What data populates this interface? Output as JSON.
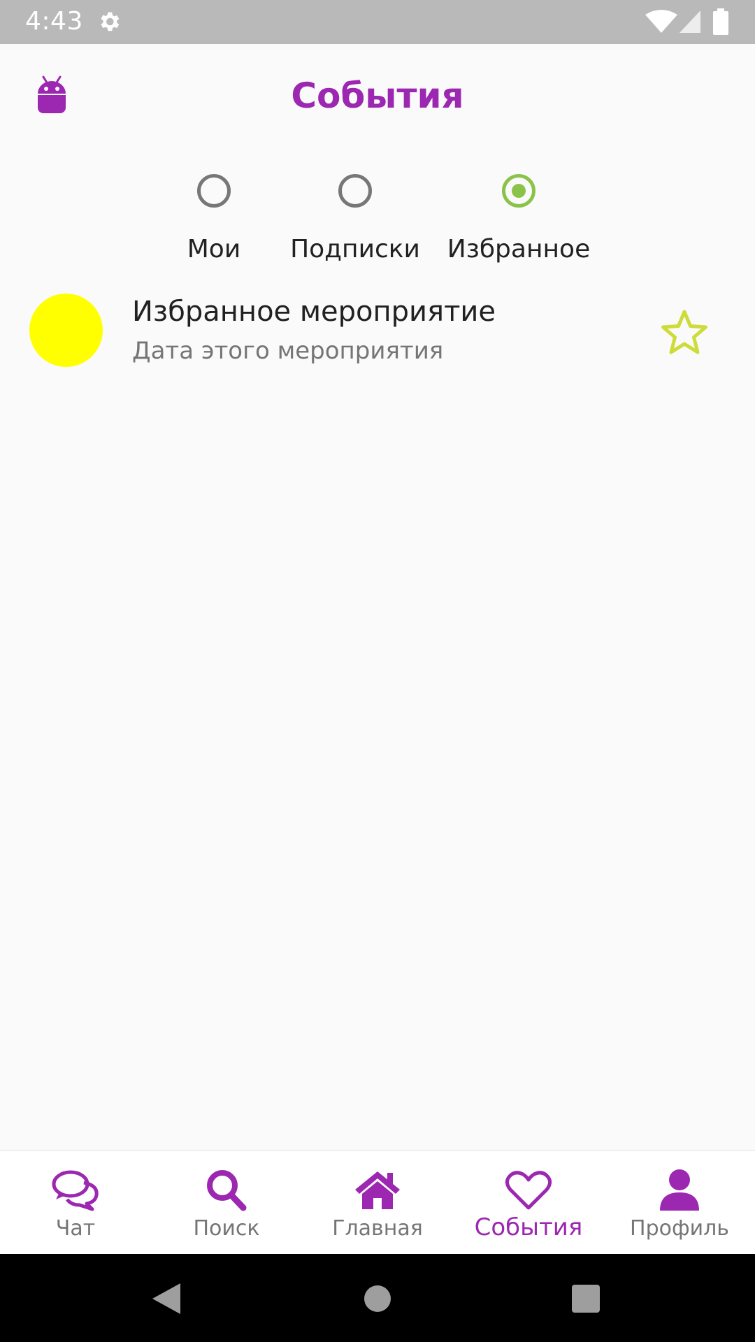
{
  "status_bar": {
    "time": "4:43"
  },
  "header": {
    "title": "События"
  },
  "filters": {
    "options": [
      {
        "label": "Мои",
        "checked": false
      },
      {
        "label": "Подписки",
        "checked": false
      },
      {
        "label": "Избранное",
        "checked": true
      }
    ]
  },
  "events": [
    {
      "title": "Избранное мероприятие",
      "subtitle": "Дата этого мероприятия",
      "avatar_color": "#ffff00",
      "favorite": true
    }
  ],
  "bottom_nav": {
    "items": [
      {
        "label": "Чат",
        "icon": "chat-icon"
      },
      {
        "label": "Поиск",
        "icon": "search-icon"
      },
      {
        "label": "Главная",
        "icon": "home-icon"
      },
      {
        "label": "События",
        "icon": "heart-icon",
        "active": true
      },
      {
        "label": "Профиль",
        "icon": "profile-icon"
      }
    ]
  },
  "colors": {
    "accent": "#9c27b0",
    "radio_checked": "#8bc34a",
    "star": "#cddc39"
  }
}
